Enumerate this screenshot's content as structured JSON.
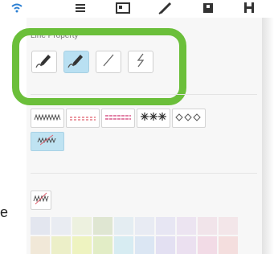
{
  "line_property": {
    "label": "Line Property"
  },
  "side_text": {
    "partial": "e"
  },
  "colors": {
    "highlight_ring": "#6bbf3a",
    "selected_bg": "#b9e0f2",
    "dashed_red": "#e0606e",
    "dashed_pink": "#d85a8a",
    "swatch_row_1": [
      "#e3e6ef",
      "#e9ecf2",
      "#edf1df",
      "#dfe6d2",
      "#e4edf2",
      "#e8ebf3",
      "#e7e6f3",
      "#ece4f1",
      "#f1e4ea",
      "#f3e6e9"
    ],
    "swatch_row_2": [
      "#f1e8d8",
      "#ecefc8",
      "#eef3c0",
      "#e2edc6",
      "#d7ecf2",
      "#dbe6f3",
      "#e3e0f2",
      "#ebe0f0",
      "#f2dbe6",
      "#f4dede"
    ]
  },
  "icons": {
    "top_bar": [
      "wifi-icon",
      "menu-icon",
      "image-icon",
      "pen-icon",
      "square-icon",
      "h-icon"
    ],
    "tools": [
      "pen-brush-icon",
      "pen-brush-selected-icon",
      "straight-line-icon",
      "zigzag-line-icon"
    ],
    "styles": [
      "zigzag-line-style",
      "dashed-red-line-style",
      "dashed-pink-double-line-style",
      "star-line-style",
      "diamond-line-style",
      "scribble-line-style"
    ]
  }
}
